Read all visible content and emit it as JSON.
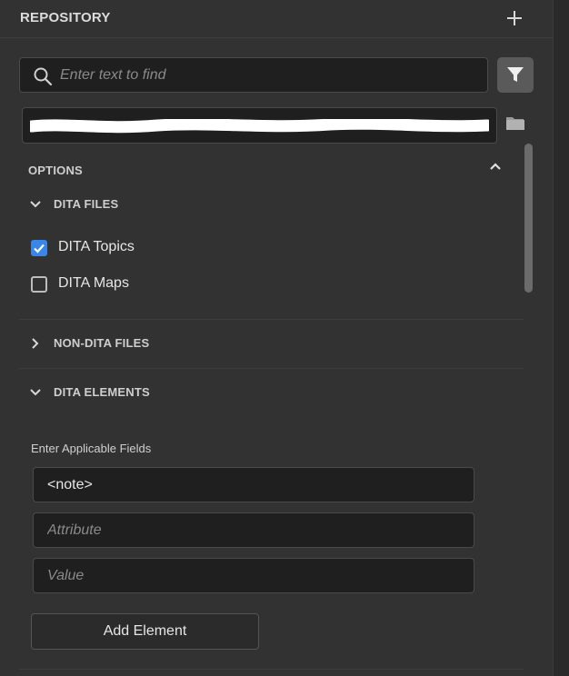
{
  "header": {
    "title": "REPOSITORY",
    "add_icon": "plus-icon"
  },
  "search": {
    "placeholder": "Enter text to find",
    "value": "",
    "icon": "search-icon",
    "filter_icon": "filter-icon"
  },
  "path": {
    "value_redacted": true,
    "folder_icon": "folder-icon"
  },
  "options": {
    "label": "OPTIONS",
    "expanded": true,
    "sections": {
      "dita_files": {
        "label": "DITA FILES",
        "expanded": true,
        "items": [
          {
            "label": "DITA Topics",
            "checked": true
          },
          {
            "label": "DITA Maps",
            "checked": false
          }
        ]
      },
      "non_dita_files": {
        "label": "NON-DITA FILES",
        "expanded": false
      },
      "dita_elements": {
        "label": "DITA ELEMENTS",
        "expanded": true,
        "fields_label": "Enter Applicable Fields",
        "element_value": "<note>",
        "attribute_placeholder": "Attribute",
        "value_placeholder": "Value",
        "add_button": "Add Element"
      }
    }
  },
  "colors": {
    "background": "#323232",
    "field_bg": "#1f1f1f",
    "accent_checkbox": "#3a86e8",
    "filter_button": "#5a5a5a"
  }
}
